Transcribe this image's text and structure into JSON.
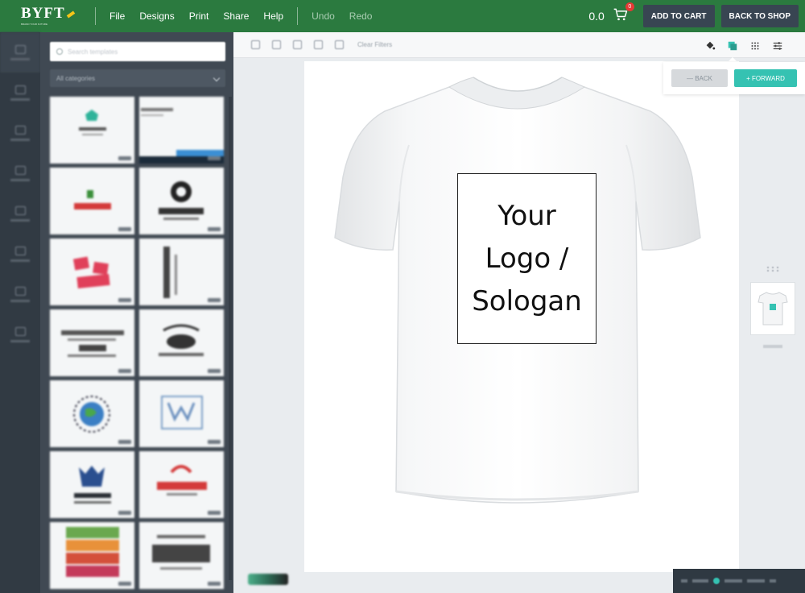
{
  "topbar": {
    "logo_text": "BYFT",
    "logo_tagline": "BRAND YOUR FUTURE",
    "menu": [
      "File",
      "Designs",
      "Print",
      "Share",
      "Help"
    ],
    "undo_label": "Undo",
    "redo_label": "Redo",
    "price": "0.0",
    "cart_count": "0",
    "add_to_cart_label": "ADD TO CART",
    "back_to_shop_label": "BACK TO SHOP"
  },
  "colors": {
    "topbar_bg": "#2b7a3f",
    "rail_bg": "#313a43",
    "panel_bg": "#404953",
    "accent_teal": "#35c2b2",
    "cart_badge": "#e53935"
  },
  "rail": {
    "items": [
      {
        "icon": "design-icon"
      },
      {
        "icon": "clipart-icon"
      },
      {
        "icon": "text-icon"
      },
      {
        "icon": "image-icon"
      },
      {
        "icon": "upload-icon"
      },
      {
        "icon": "shape-icon"
      },
      {
        "icon": "layer-icon"
      },
      {
        "icon": "qr-icon"
      }
    ]
  },
  "panel": {
    "search_placeholder": "Search templates",
    "category_selected": "All categories",
    "templates_count": 12
  },
  "toolbar": {
    "clear_filters_label": "Clear Filters"
  },
  "arrange": {
    "back_label": "— BACK",
    "forward_label": "+ FORWARD"
  },
  "canvas": {
    "logo_placeholder": "Your\nLogo /\nSologan",
    "product": "white t-shirt"
  }
}
